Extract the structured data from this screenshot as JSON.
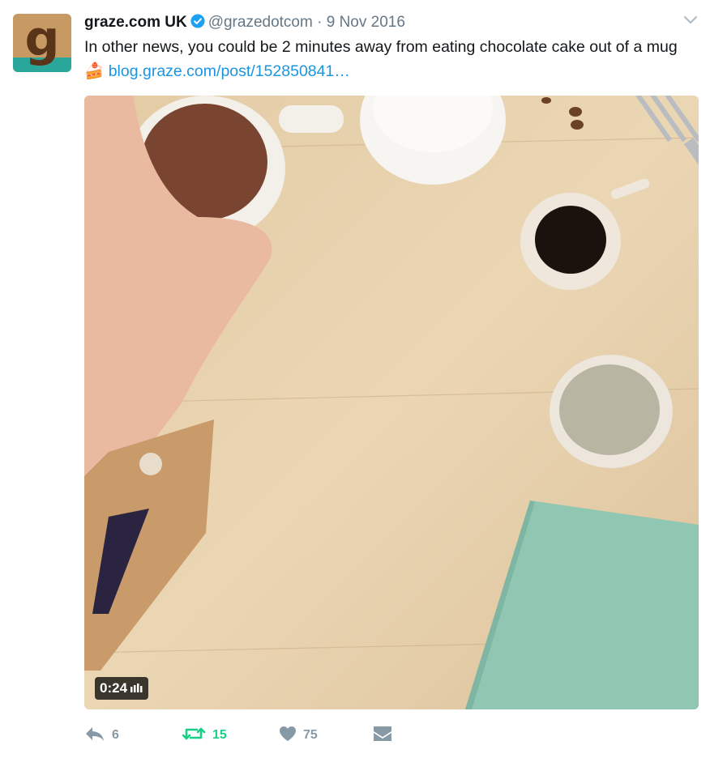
{
  "tweet": {
    "name": "graze.com UK",
    "handle": "@grazedotcom",
    "separator": "·",
    "date": "9 Nov 2016",
    "text_before": "In other news, you could be 2 minutes away from eating chocolate cake out of a mug ",
    "emoji": "🍰",
    "link": "blog.graze.com/post/152850841…",
    "avatar_letter": "g"
  },
  "video": {
    "duration": "0:24"
  },
  "actions": {
    "reply_count": "6",
    "retweet_count": "15",
    "like_count": "75"
  },
  "icons": [
    "verified-icon",
    "chevron-down-icon",
    "reply-icon",
    "retweet-icon",
    "heart-icon",
    "message-icon",
    "volume-icon"
  ],
  "colors": {
    "link": "#1b95e0",
    "retweet_active": "#19cf86",
    "muted": "#8899a6",
    "verified": "#1da1f2"
  }
}
